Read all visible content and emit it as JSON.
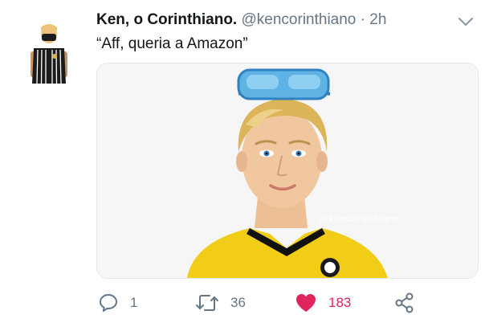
{
  "tweet": {
    "author_name": "Ken, o Corinthiano.",
    "handle": "@kencorinthiano",
    "separator": "·",
    "time": "2h",
    "text": "“Aff, queria a Amazon”",
    "media": {
      "watermark": "@kencorinthiano"
    }
  },
  "actions": {
    "reply_count": "1",
    "retweet_count": "36",
    "like_count": "183",
    "liked": true
  },
  "colors": {
    "like_active": "#e0245e",
    "secondary_text": "#657786",
    "border": "#e1e8ed"
  }
}
